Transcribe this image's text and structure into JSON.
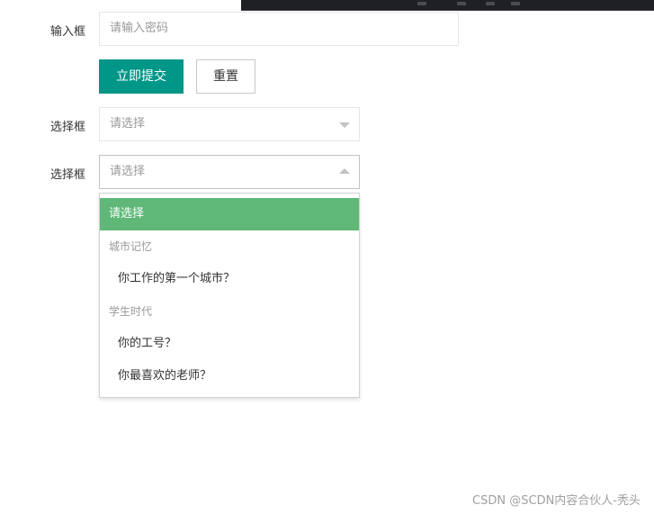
{
  "form": {
    "input_label": "输入框",
    "password_placeholder": "请输入密码",
    "submit_label": "立即提交",
    "reset_label": "重置",
    "select1_label": "选择框",
    "select1_value": "请选择",
    "select2_label": "选择框",
    "select2_value": "请选择"
  },
  "dropdown": {
    "selected_option": "请选择",
    "groups": [
      {
        "label": "城市记忆",
        "options": [
          "你工作的第一个城市？"
        ]
      },
      {
        "label": "学生时代",
        "options": [
          "你的工号？",
          "你最喜欢的老师？"
        ]
      }
    ]
  },
  "watermark": "CSDN @SCDN内容合伙人-秃头",
  "colors": {
    "primary": "#009688",
    "selected_option_bg": "#5fb878",
    "border": "#e6e6e6",
    "placeholder": "#999999"
  },
  "icons": {
    "select1_caret": "caret-down-icon",
    "select2_caret": "caret-up-icon"
  }
}
